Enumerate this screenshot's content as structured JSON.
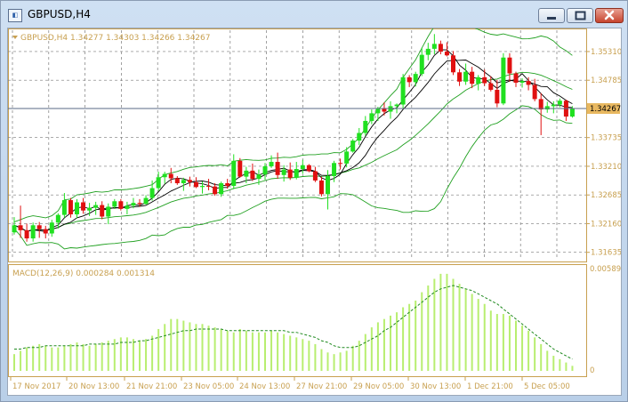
{
  "window": {
    "title": "GBPUSD,H4",
    "app_icon": "metatrader-chart-icon"
  },
  "main_chart": {
    "info_line": "GBPUSD,H4  1.34277 1.34303 1.34266 1.34267",
    "current_price": "1.34267",
    "price_labels": [
      "1.35310",
      "1.34785",
      "1.34267",
      "1.33735",
      "1.33210",
      "1.32685",
      "1.32160",
      "1.31635"
    ]
  },
  "macd": {
    "info_line": "MACD(12,26,9) 0.000284 0.001314",
    "top_label": "0.005899",
    "zero_label": "0"
  },
  "time_axis": [
    "17 Nov 2017",
    "20 Nov 13:00",
    "21 Nov 21:00",
    "23 Nov 05:00",
    "24 Nov 13:00",
    "27 Nov 21:00",
    "29 Nov 05:00",
    "30 Nov 13:00",
    "1 Dec 21:00",
    "5 Dec 05:00"
  ],
  "colors": {
    "bull": "#20e020",
    "bear": "#e01010",
    "axis": "#c8a050",
    "grid": "#7a7a7a",
    "band": "#20a020",
    "macd_hist": "#b8ee70",
    "signal": "#208a20",
    "price_tag_bg": "#e8b860"
  },
  "chart_data": {
    "type": "candlestick",
    "symbol": "GBPUSD",
    "timeframe": "H4",
    "ylim": [
      1.315,
      1.357
    ],
    "candles_ohlc": [
      [
        1.32,
        1.3228,
        1.3196,
        1.3213
      ],
      [
        1.3213,
        1.3249,
        1.319,
        1.3204
      ],
      [
        1.3204,
        1.3216,
        1.3183,
        1.3189
      ],
      [
        1.3189,
        1.3218,
        1.3183,
        1.3213
      ],
      [
        1.3213,
        1.3219,
        1.319,
        1.3206
      ],
      [
        1.3206,
        1.3212,
        1.3189,
        1.3198
      ],
      [
        1.3198,
        1.3223,
        1.3192,
        1.3218
      ],
      [
        1.3218,
        1.3235,
        1.3207,
        1.3232
      ],
      [
        1.3232,
        1.3272,
        1.3227,
        1.3259
      ],
      [
        1.3259,
        1.3263,
        1.3227,
        1.3233
      ],
      [
        1.3233,
        1.3261,
        1.3226,
        1.3255
      ],
      [
        1.3255,
        1.3263,
        1.3234,
        1.324
      ],
      [
        1.324,
        1.3254,
        1.323,
        1.3245
      ],
      [
        1.3245,
        1.3256,
        1.3232,
        1.325
      ],
      [
        1.325,
        1.3257,
        1.3224,
        1.3229
      ],
      [
        1.3229,
        1.3253,
        1.3215,
        1.3247
      ],
      [
        1.3247,
        1.3261,
        1.3243,
        1.3257
      ],
      [
        1.3257,
        1.3261,
        1.324,
        1.3243
      ],
      [
        1.3243,
        1.3256,
        1.3233,
        1.3249
      ],
      [
        1.3249,
        1.3263,
        1.3244,
        1.3254
      ],
      [
        1.3254,
        1.3261,
        1.3247,
        1.3252
      ],
      [
        1.3252,
        1.3268,
        1.3251,
        1.3263
      ],
      [
        1.3263,
        1.3295,
        1.3258,
        1.3281
      ],
      [
        1.3281,
        1.3311,
        1.3276,
        1.3301
      ],
      [
        1.3301,
        1.3311,
        1.3289,
        1.3307
      ],
      [
        1.3307,
        1.3318,
        1.329,
        1.3299
      ],
      [
        1.3299,
        1.3303,
        1.3287,
        1.329
      ],
      [
        1.329,
        1.33,
        1.3276,
        1.3296
      ],
      [
        1.3296,
        1.3302,
        1.3284,
        1.3292
      ],
      [
        1.3292,
        1.3301,
        1.3281,
        1.3283
      ],
      [
        1.3283,
        1.3293,
        1.3271,
        1.3285
      ],
      [
        1.3285,
        1.3298,
        1.3277,
        1.3284
      ],
      [
        1.3284,
        1.329,
        1.3267,
        1.327
      ],
      [
        1.327,
        1.3293,
        1.3265,
        1.329
      ],
      [
        1.329,
        1.3298,
        1.328,
        1.3285
      ],
      [
        1.3285,
        1.3343,
        1.3279,
        1.3331
      ],
      [
        1.3331,
        1.3336,
        1.33,
        1.3302
      ],
      [
        1.3302,
        1.332,
        1.329,
        1.3313
      ],
      [
        1.3313,
        1.3326,
        1.3294,
        1.3298
      ],
      [
        1.3298,
        1.3315,
        1.3287,
        1.3306
      ],
      [
        1.3306,
        1.3327,
        1.3296,
        1.3321
      ],
      [
        1.3321,
        1.3341,
        1.3318,
        1.3329
      ],
      [
        1.3329,
        1.3346,
        1.3298,
        1.3305
      ],
      [
        1.3305,
        1.3323,
        1.3293,
        1.3315
      ],
      [
        1.3315,
        1.3328,
        1.3296,
        1.33
      ],
      [
        1.33,
        1.3329,
        1.3297,
        1.3316
      ],
      [
        1.3316,
        1.3333,
        1.3307,
        1.3323
      ],
      [
        1.3323,
        1.3325,
        1.331,
        1.3312
      ],
      [
        1.3312,
        1.332,
        1.3292,
        1.3295
      ],
      [
        1.3295,
        1.3302,
        1.3266,
        1.327
      ],
      [
        1.327,
        1.3314,
        1.3242,
        1.3303
      ],
      [
        1.3303,
        1.3331,
        1.3292,
        1.3327
      ],
      [
        1.3327,
        1.3335,
        1.3315,
        1.3326
      ],
      [
        1.3326,
        1.3356,
        1.3319,
        1.3348
      ],
      [
        1.3348,
        1.3371,
        1.3346,
        1.3368
      ],
      [
        1.3368,
        1.3391,
        1.336,
        1.3382
      ],
      [
        1.3382,
        1.3413,
        1.3377,
        1.3404
      ],
      [
        1.3404,
        1.3425,
        1.3398,
        1.3418
      ],
      [
        1.3418,
        1.343,
        1.3404,
        1.3426
      ],
      [
        1.3426,
        1.3438,
        1.3414,
        1.3421
      ],
      [
        1.3421,
        1.344,
        1.3408,
        1.3431
      ],
      [
        1.3431,
        1.3436,
        1.3418,
        1.3434
      ],
      [
        1.3434,
        1.349,
        1.3427,
        1.3484
      ],
      [
        1.3484,
        1.3488,
        1.3466,
        1.3475
      ],
      [
        1.3475,
        1.3494,
        1.3467,
        1.349
      ],
      [
        1.349,
        1.3538,
        1.3486,
        1.3525
      ],
      [
        1.3525,
        1.3547,
        1.3515,
        1.3536
      ],
      [
        1.3536,
        1.3563,
        1.3526,
        1.3545
      ],
      [
        1.3545,
        1.3551,
        1.3526,
        1.3531
      ],
      [
        1.3531,
        1.3548,
        1.3522,
        1.3524
      ],
      [
        1.3524,
        1.3532,
        1.3488,
        1.3493
      ],
      [
        1.3493,
        1.3499,
        1.3468,
        1.3476
      ],
      [
        1.3476,
        1.3509,
        1.347,
        1.3494
      ],
      [
        1.3494,
        1.3503,
        1.3464,
        1.3472
      ],
      [
        1.3472,
        1.3488,
        1.346,
        1.3484
      ],
      [
        1.3484,
        1.3498,
        1.3468,
        1.3473
      ],
      [
        1.3473,
        1.3486,
        1.3458,
        1.3461
      ],
      [
        1.3461,
        1.3479,
        1.3429,
        1.3436
      ],
      [
        1.3436,
        1.3528,
        1.3433,
        1.352
      ],
      [
        1.352,
        1.3528,
        1.3476,
        1.3491
      ],
      [
        1.3491,
        1.3494,
        1.3466,
        1.3474
      ],
      [
        1.3474,
        1.3482,
        1.3465,
        1.3477
      ],
      [
        1.3477,
        1.3484,
        1.346,
        1.347
      ],
      [
        1.347,
        1.3481,
        1.344,
        1.3444
      ],
      [
        1.3444,
        1.3455,
        1.3378,
        1.3425
      ],
      [
        1.3425,
        1.3439,
        1.3419,
        1.3431
      ],
      [
        1.3431,
        1.344,
        1.3418,
        1.3434
      ],
      [
        1.3434,
        1.3445,
        1.3429,
        1.3441
      ],
      [
        1.3441,
        1.3443,
        1.3404,
        1.3412
      ],
      [
        1.3412,
        1.3431,
        1.341,
        1.3427
      ]
    ],
    "macd_hist": [
      0.001,
      0.0012,
      0.0014,
      0.0015,
      0.0016,
      0.0015,
      0.0014,
      0.0014,
      0.0015,
      0.0016,
      0.0017,
      0.0016,
      0.0015,
      0.0016,
      0.0017,
      0.0018,
      0.0019,
      0.002,
      0.002,
      0.0019,
      0.0018,
      0.0019,
      0.0021,
      0.0025,
      0.0028,
      0.0031,
      0.0031,
      0.003,
      0.0029,
      0.0028,
      0.0028,
      0.0027,
      0.0026,
      0.0025,
      0.0024,
      0.0023,
      0.0025,
      0.0024,
      0.0023,
      0.0023,
      0.0023,
      0.0024,
      0.0023,
      0.0022,
      0.0021,
      0.002,
      0.0019,
      0.0018,
      0.0016,
      0.0013,
      0.0011,
      0.001,
      0.0011,
      0.0012,
      0.0015,
      0.0018,
      0.0022,
      0.0026,
      0.0029,
      0.0031,
      0.0033,
      0.0035,
      0.0038,
      0.004,
      0.0042,
      0.0047,
      0.0051,
      0.0055,
      0.0058,
      0.0058,
      0.0055,
      0.0052,
      0.0049,
      0.0046,
      0.0043,
      0.004,
      0.0036,
      0.0034,
      0.0034,
      0.0033,
      0.003,
      0.0027,
      0.0024,
      0.002,
      0.0016,
      0.0012,
      0.0009,
      0.0007,
      0.0005,
      0.0003
    ],
    "signal": [
      0.0013,
      0.0013,
      0.0014,
      0.0014,
      0.0014,
      0.0015,
      0.0015,
      0.0015,
      0.0015,
      0.0015,
      0.0015,
      0.0015,
      0.0016,
      0.0016,
      0.0016,
      0.0016,
      0.0016,
      0.0017,
      0.0017,
      0.0017,
      0.0018,
      0.0018,
      0.0019,
      0.002,
      0.0021,
      0.0022,
      0.0023,
      0.0024,
      0.0024,
      0.0025,
      0.0025,
      0.0025,
      0.0025,
      0.0025,
      0.0024,
      0.0024,
      0.0024,
      0.0024,
      0.0024,
      0.0024,
      0.0024,
      0.0024,
      0.0024,
      0.0024,
      0.0023,
      0.0023,
      0.0022,
      0.0021,
      0.002,
      0.0018,
      0.0017,
      0.0015,
      0.0014,
      0.0014,
      0.0014,
      0.0015,
      0.0017,
      0.0019,
      0.0021,
      0.0024,
      0.0026,
      0.0029,
      0.0032,
      0.0035,
      0.0038,
      0.0041,
      0.0044,
      0.0047,
      0.0049,
      0.005,
      0.0051,
      0.005,
      0.0049,
      0.0048,
      0.0046,
      0.0044,
      0.0042,
      0.004,
      0.0037,
      0.0034,
      0.0031,
      0.0028,
      0.0025,
      0.0022,
      0.0019,
      0.0016,
      0.0013,
      0.0011,
      0.0009,
      0.0007
    ],
    "macd_ylim": [
      0,
      0.005899
    ]
  }
}
